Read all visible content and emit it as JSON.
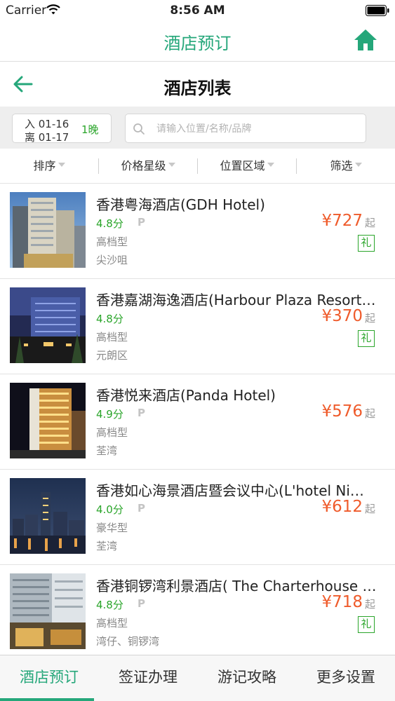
{
  "status_bar": {
    "carrier": "Carrier",
    "time": "8:56 AM"
  },
  "app_header": {
    "title": "酒店预订",
    "home_icon": "home-icon"
  },
  "sub_header": {
    "title": "酒店列表",
    "back_icon": "back-arrow-icon"
  },
  "dates": {
    "checkin": "入 01-16",
    "checkout": "离 01-17",
    "nights": "1晚"
  },
  "search": {
    "placeholder": "请输入位置/名称/品牌",
    "value": ""
  },
  "filters": [
    "排序",
    "价格星级",
    "位置区域",
    "筛选"
  ],
  "hotels": [
    {
      "name": "香港粤海酒店(GDH Hotel)",
      "rating": "4.8分",
      "parking": "P",
      "grade": "高档型",
      "district": "尖沙咀",
      "price": "¥727",
      "suffix": "起",
      "gift": "礼"
    },
    {
      "name": "香港嘉湖海逸酒店(Harbour Plaza Resort…",
      "rating": "4.8分",
      "parking": "",
      "grade": "高档型",
      "district": "元朗区",
      "price": "¥370",
      "suffix": "起",
      "gift": "礼"
    },
    {
      "name": "香港悦来酒店(Panda Hotel)",
      "rating": "4.9分",
      "parking": "P",
      "grade": "高档型",
      "district": "荃湾",
      "price": "¥576",
      "suffix": "起",
      "gift": ""
    },
    {
      "name": "香港如心海景酒店暨会议中心(L'hotel Ni…",
      "rating": "4.0分",
      "parking": "P",
      "grade": "豪华型",
      "district": "荃湾",
      "price": "¥612",
      "suffix": "起",
      "gift": ""
    },
    {
      "name": "香港铜锣湾利景酒店( The Charterhouse …",
      "rating": "4.8分",
      "parking": "P",
      "grade": "高档型",
      "district": "湾仔、铜锣湾",
      "price": "¥718",
      "suffix": "起",
      "gift": "礼"
    }
  ],
  "tabs": [
    "酒店预订",
    "签证办理",
    "游记攻略",
    "更多设置"
  ],
  "active_tab": 0,
  "colors": {
    "brand_green": "#25a77a",
    "rating_green": "#2aa52a",
    "price_orange": "#ef5b2b"
  }
}
